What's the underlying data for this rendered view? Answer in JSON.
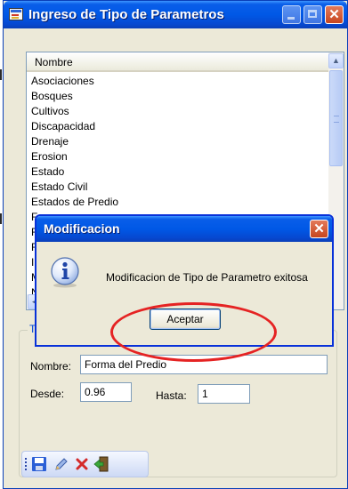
{
  "window": {
    "title": "Ingreso de Tipo de Parametros",
    "minimize_icon": "minimize-icon",
    "maximize_icon": "maximize-icon",
    "close_glyph": "✕"
  },
  "list": {
    "column_header": "Nombre",
    "items": [
      "Asociaciones",
      "Bosques",
      "Cultivos",
      "Discapacidad",
      "Drenaje",
      "Erosion",
      "Estado",
      "Estado Civil",
      "Estados de Predio",
      "F",
      "F",
      "F",
      "Ir",
      "M",
      "N"
    ]
  },
  "group": {
    "caption": "T"
  },
  "form": {
    "nombre_label": "Nombre:",
    "nombre_value": "Forma del Predio",
    "desde_label": "Desde:",
    "desde_value": "0.96",
    "hasta_label": "Hasta:",
    "hasta_value": "1"
  },
  "toolbar": {
    "icons": [
      "save-icon",
      "edit-icon",
      "delete-icon",
      "exit-icon"
    ]
  },
  "dialog": {
    "title": "Modificacion",
    "message": "Modificacion de Tipo de Parametro exitosa",
    "accept_label": "Aceptar",
    "close_glyph": "✕",
    "icon": "info-icon"
  },
  "annotation": {
    "highlight_color": "#e52323"
  },
  "colors": {
    "titlebar_blue": "#0058e6",
    "window_face": "#ece9d8",
    "group_caption": "#0046d5"
  }
}
